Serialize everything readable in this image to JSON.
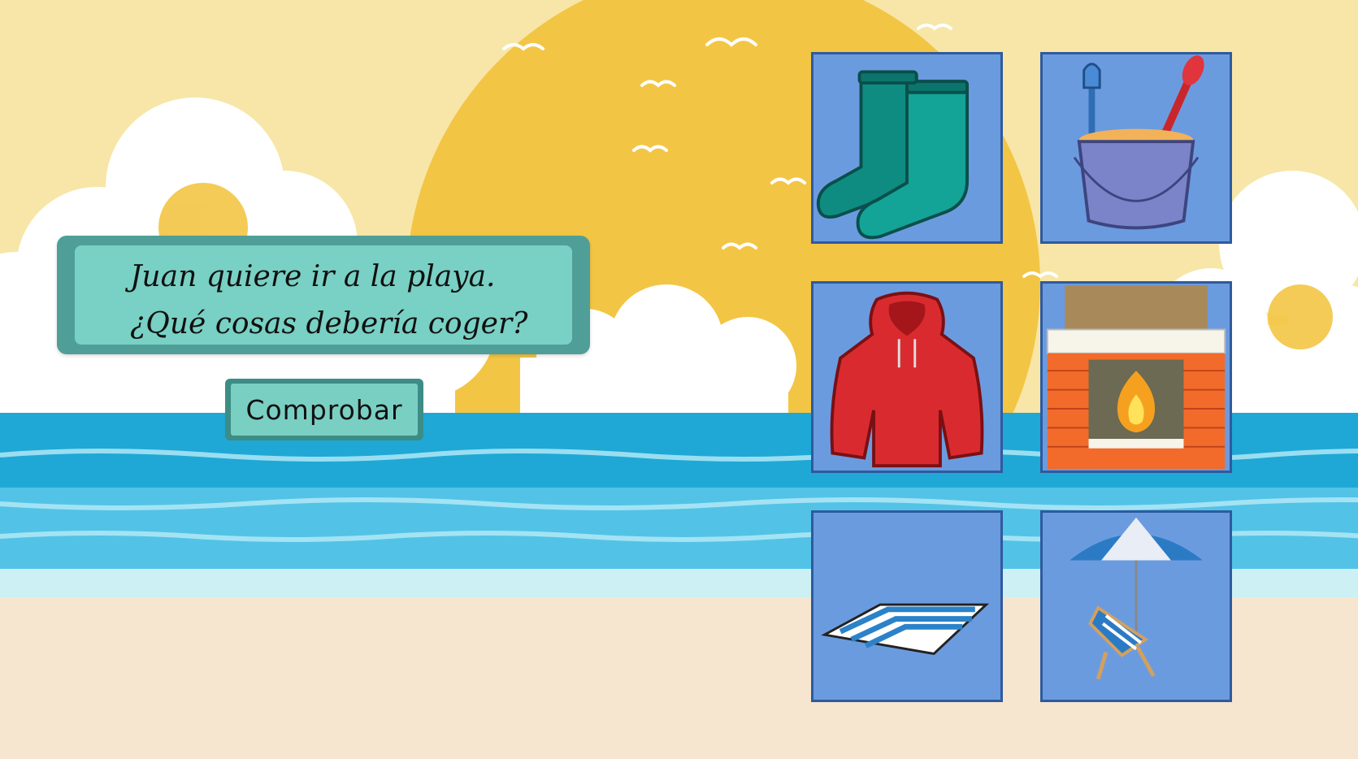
{
  "question": {
    "line1": "Juan quiere ir a la playa.",
    "line2": "¿Qué cosas debería coger?"
  },
  "check_button": {
    "label": "Comprobar"
  },
  "options": [
    {
      "icon": "rain-boots-icon"
    },
    {
      "icon": "sand-bucket-icon"
    },
    {
      "icon": "red-raincoat-icon"
    },
    {
      "icon": "fireplace-icon"
    },
    {
      "icon": "beach-towel-icon"
    },
    {
      "icon": "beach-umbrella-chair-icon"
    }
  ],
  "colors": {
    "sky": "#f7e6a7",
    "sun": "#f3c544",
    "sea": "#1fa8d6",
    "sand": "#f6e6cf",
    "card": "#6b9bdf",
    "question_box": "#79d0c4"
  }
}
